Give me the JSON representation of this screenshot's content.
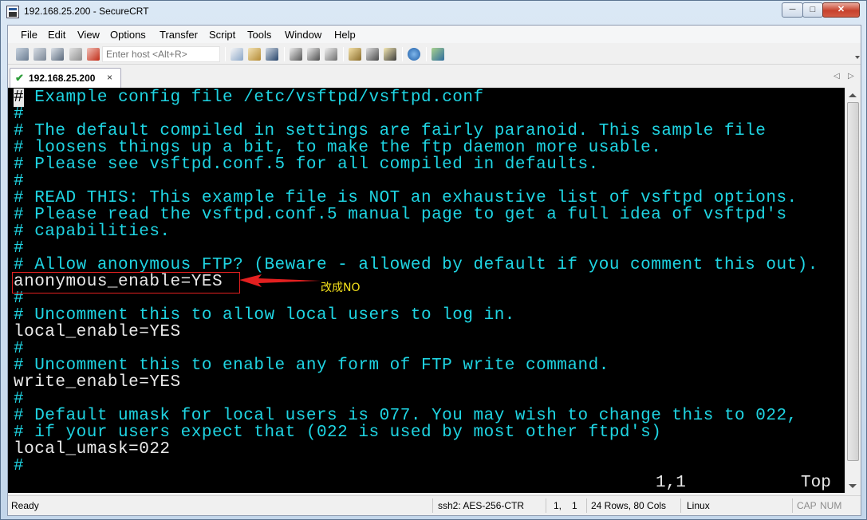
{
  "window": {
    "title": "192.168.25.200 - SecureCRT",
    "minimize_glyph": "─",
    "maximize_glyph": "□",
    "close_glyph": "✕"
  },
  "menu": [
    "File",
    "Edit",
    "View",
    "Options",
    "Transfer",
    "Script",
    "Tools",
    "Window",
    "Help"
  ],
  "toolbar": {
    "host_placeholder": "Enter host <Alt+R>",
    "icons": [
      "connect-icon",
      "quick-connect-icon",
      "connect-in-tab-icon",
      "reconnect-icon",
      "disconnect-icon",
      "copy-icon",
      "paste-icon",
      "find-icon",
      "print-icon",
      "print-selection-icon",
      "print-setup-icon",
      "session-options-icon",
      "global-options-icon",
      "keymap-icon",
      "help-icon",
      "sftp-icon"
    ]
  },
  "tab": {
    "label": "192.168.25.200",
    "close": "×",
    "nav_left": "◁",
    "nav_right": "▷"
  },
  "terminal": {
    "lines": [
      {
        "cursor": "#",
        "text": " Example config file /etc/vsftpd/vsftpd.conf",
        "color": "cyan"
      },
      {
        "text": "#",
        "color": "cyan"
      },
      {
        "text": "# The default compiled in settings are fairly paranoid. This sample file",
        "color": "cyan"
      },
      {
        "text": "# loosens things up a bit, to make the ftp daemon more usable.",
        "color": "cyan"
      },
      {
        "text": "# Please see vsftpd.conf.5 for all compiled in defaults.",
        "color": "cyan"
      },
      {
        "text": "#",
        "color": "cyan"
      },
      {
        "text": "# READ THIS: This example file is NOT an exhaustive list of vsftpd options.",
        "color": "cyan"
      },
      {
        "text": "# Please read the vsftpd.conf.5 manual page to get a full idea of vsftpd's",
        "color": "cyan"
      },
      {
        "text": "# capabilities.",
        "color": "cyan"
      },
      {
        "text": "#",
        "color": "cyan"
      },
      {
        "text": "# Allow anonymous FTP? (Beware - allowed by default if you comment this out).",
        "color": "cyan"
      },
      {
        "text": "anonymous_enable=YES",
        "color": "white"
      },
      {
        "text": "#",
        "color": "cyan"
      },
      {
        "text": "# Uncomment this to allow local users to log in.",
        "color": "cyan"
      },
      {
        "text": "local_enable=YES",
        "color": "white"
      },
      {
        "text": "#",
        "color": "cyan"
      },
      {
        "text": "# Uncomment this to enable any form of FTP write command.",
        "color": "cyan"
      },
      {
        "text": "write_enable=YES",
        "color": "white"
      },
      {
        "text": "#",
        "color": "cyan"
      },
      {
        "text": "# Default umask for local users is 077. You may wish to change this to 022,",
        "color": "cyan"
      },
      {
        "text": "# if your users expect that (022 is used by most other ftpd's)",
        "color": "cyan"
      },
      {
        "text": "local_umask=022",
        "color": "white"
      },
      {
        "text": "#",
        "color": "cyan"
      }
    ],
    "cursor_position": "1,1",
    "scroll_indicator": "Top",
    "colors": {
      "comment": "#1fd5e3",
      "setting": "#e9e9e9",
      "background": "#000000"
    }
  },
  "annotation": {
    "text": "改成NO",
    "box_color": "#e32020",
    "text_color": "#f5e11b"
  },
  "statusbar": {
    "status": "Ready",
    "cipher": "ssh2: AES-256-CTR",
    "row": "1,",
    "col": "1",
    "size": "24 Rows, 80 Cols",
    "os": "Linux",
    "caps": "CAP",
    "num": "NUM"
  }
}
